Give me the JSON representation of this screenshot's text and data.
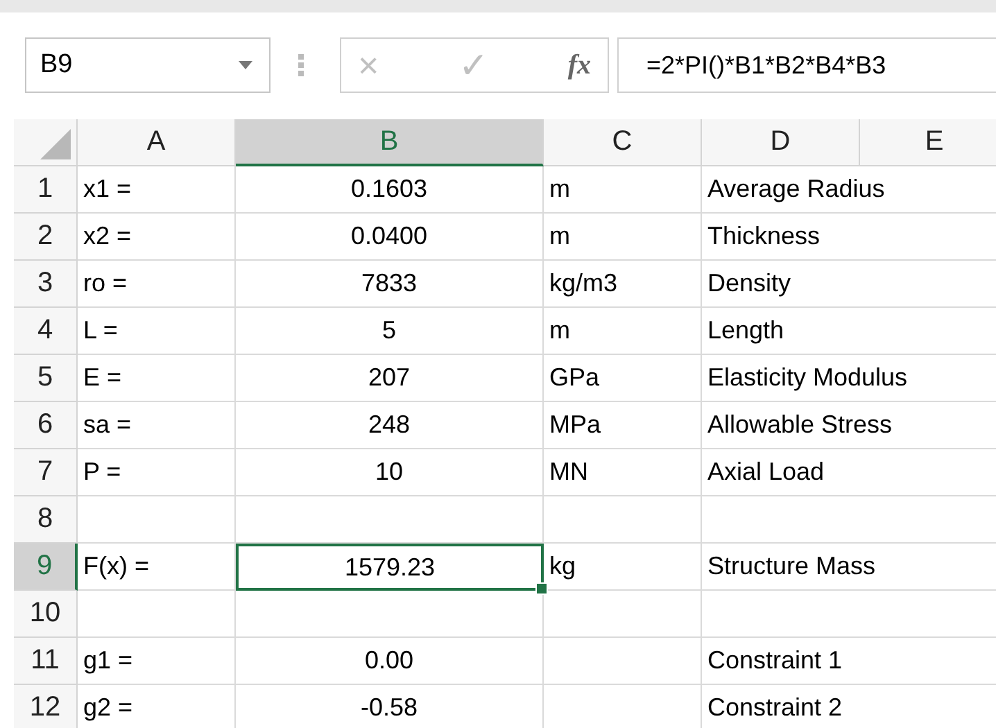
{
  "name_box": "B9",
  "formula_bar": {
    "cancel": "×",
    "enter": "✓",
    "function": "fx",
    "formula": "=2*PI()*B1*B2*B4*B3"
  },
  "columns": [
    {
      "label": "A",
      "selected": false
    },
    {
      "label": "B",
      "selected": true
    },
    {
      "label": "C",
      "selected": false
    },
    {
      "label": "D",
      "selected": false
    },
    {
      "label": "E",
      "selected": false
    }
  ],
  "rows": [
    {
      "number": "1",
      "selected": false,
      "a": "x1 =",
      "b": "0.1603",
      "c": "m",
      "d": "Average Radius"
    },
    {
      "number": "2",
      "selected": false,
      "a": "x2 =",
      "b": "0.0400",
      "c": "m",
      "d": "Thickness"
    },
    {
      "number": "3",
      "selected": false,
      "a": "ro =",
      "b": "7833",
      "c": "kg/m3",
      "d": "Density"
    },
    {
      "number": "4",
      "selected": false,
      "a": "L =",
      "b": "5",
      "c": "m",
      "d": "Length"
    },
    {
      "number": "5",
      "selected": false,
      "a": "E =",
      "b": "207",
      "c": "GPa",
      "d": "Elasticity Modulus"
    },
    {
      "number": "6",
      "selected": false,
      "a": "sa =",
      "b": "248",
      "c": "MPa",
      "d": "Allowable Stress"
    },
    {
      "number": "7",
      "selected": false,
      "a": "P =",
      "b": "10",
      "c": "MN",
      "d": "Axial Load"
    },
    {
      "number": "8",
      "selected": false
    },
    {
      "number": "9",
      "selected": true,
      "a": "F(x) =",
      "b": "1579.23",
      "c": "kg",
      "d": "Structure Mass"
    },
    {
      "number": "10",
      "selected": false
    },
    {
      "number": "11",
      "selected": false,
      "a": "g1 =",
      "b": "0.00",
      "d": "Constraint 1"
    },
    {
      "number": "12",
      "selected": false,
      "a": "g2 =",
      "b": "-0.58",
      "d": "Constraint 2"
    }
  ]
}
